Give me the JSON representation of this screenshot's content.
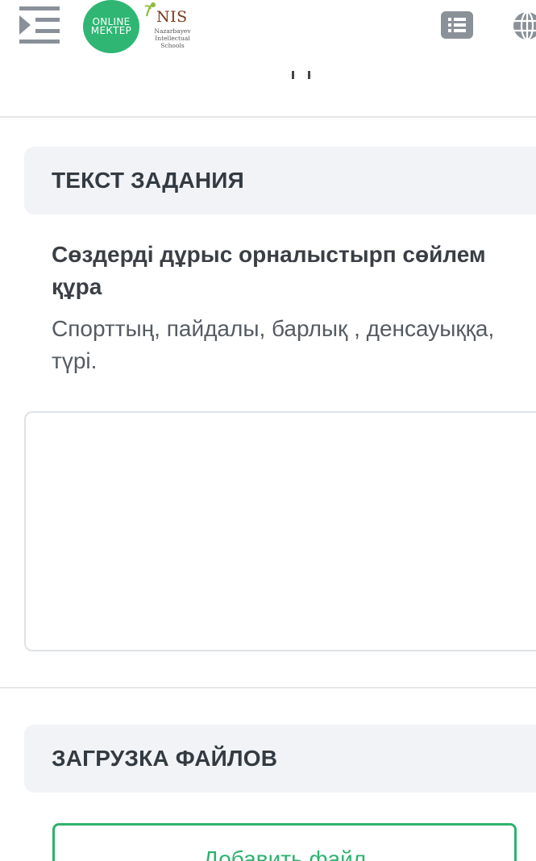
{
  "header": {
    "menu_icon": "indent-menu-icon",
    "online_mektep_logo": [
      "ONLINE",
      "МЕКТЕР"
    ],
    "nis_logo": {
      "word": "NIS",
      "sub": [
        "Nazarbayev",
        "Intellectual",
        "Schools"
      ]
    },
    "list_icon": "list-icon",
    "globe_icon": "globe-icon"
  },
  "task_section": {
    "header": "ТЕКСТ ЗАДАНИЯ",
    "title": "Сөздерді дұрыс орналыстырп сөйлем құра",
    "text": "Спорттың, пайдалы, барлық , денсауыққа, түрі."
  },
  "answer": {
    "value": ""
  },
  "upload_section": {
    "header": "ЗАГРУЗКА ФАЙЛОВ",
    "add_file_label": "Добавить файл"
  },
  "colors": {
    "accent_green": "#2eb26e",
    "header_bg": "#f1f3f6",
    "nis_brown": "#7a3a1c"
  }
}
